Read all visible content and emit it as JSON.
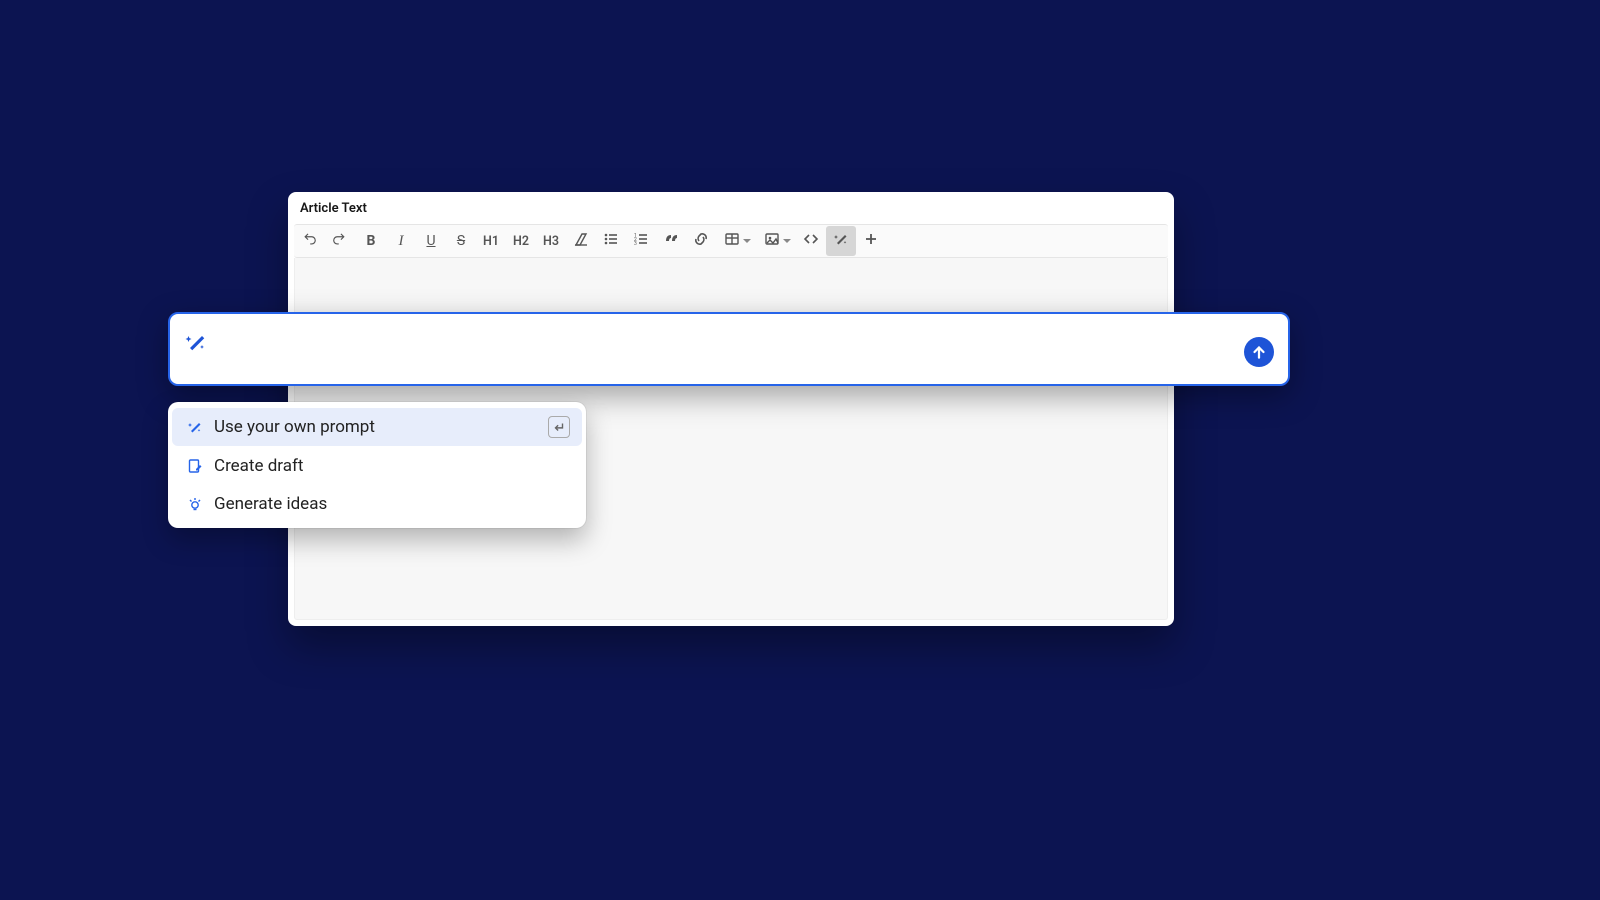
{
  "window": {
    "title": "Article Text"
  },
  "toolbar": {
    "items": [
      {
        "id": "undo",
        "type": "svg",
        "name": "undo-icon"
      },
      {
        "id": "redo",
        "type": "svg",
        "name": "redo-icon"
      },
      {
        "id": "bold",
        "type": "text",
        "cls": "txtB",
        "label": "B",
        "name": "bold-icon"
      },
      {
        "id": "italic",
        "type": "text",
        "cls": "txtI",
        "label": "I",
        "name": "italic-icon"
      },
      {
        "id": "underline",
        "type": "text",
        "cls": "txtU",
        "label": "U",
        "name": "underline-icon"
      },
      {
        "id": "strike",
        "type": "text",
        "cls": "txtS",
        "label": "S",
        "name": "strikethrough-icon"
      },
      {
        "id": "h1",
        "type": "hlabel",
        "label": "H1",
        "name": "heading1-button"
      },
      {
        "id": "h2",
        "type": "hlabel",
        "label": "H2",
        "name": "heading2-button"
      },
      {
        "id": "h3",
        "type": "hlabel",
        "label": "H3",
        "name": "heading3-button"
      },
      {
        "id": "clear",
        "type": "svg",
        "name": "clear-format-icon"
      },
      {
        "id": "ul",
        "type": "svg",
        "name": "bullet-list-icon"
      },
      {
        "id": "ol",
        "type": "svg",
        "name": "numbered-list-icon"
      },
      {
        "id": "quote",
        "type": "svg",
        "name": "blockquote-icon"
      },
      {
        "id": "link",
        "type": "svg",
        "name": "link-icon"
      },
      {
        "id": "table",
        "type": "svg",
        "drop": true,
        "name": "table-icon"
      },
      {
        "id": "image",
        "type": "svg",
        "drop": true,
        "name": "image-icon"
      },
      {
        "id": "code",
        "type": "svg",
        "name": "code-icon"
      },
      {
        "id": "ai",
        "type": "svg",
        "name": "ai-wand-icon",
        "active": true
      },
      {
        "id": "add",
        "type": "svg",
        "name": "plus-icon"
      }
    ]
  },
  "prompt": {
    "value": "",
    "send_name": "send-button"
  },
  "suggestions": [
    {
      "label": "Use your own prompt",
      "icon": "wand",
      "selected": true,
      "kbd": "enter"
    },
    {
      "label": "Create draft",
      "icon": "draft",
      "selected": false
    },
    {
      "label": "Generate ideas",
      "icon": "idea",
      "selected": false
    }
  ]
}
